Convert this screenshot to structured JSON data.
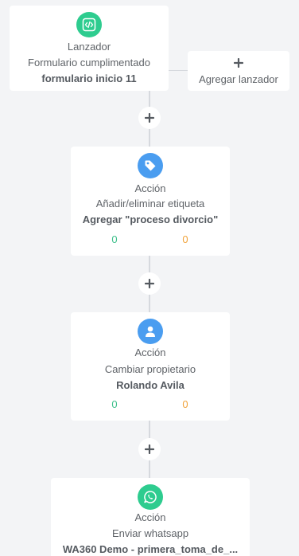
{
  "trigger": {
    "icon": "code-icon",
    "icon_color": "#2ecc8f",
    "type_label": "Lanzador",
    "event_label": "Formulario cumplimentado",
    "detail_label": "formulario inicio 11"
  },
  "add_trigger": {
    "label": "Agregar lanzador",
    "icon": "plus-icon"
  },
  "actions": [
    {
      "icon": "tag-icon",
      "icon_color": "#4a9df0",
      "type_label": "Acción",
      "action_label": "Añadir/eliminar etiqueta",
      "detail_label": "Agregar \"proceso divorcio\"",
      "success_count": "0",
      "pending_count": "0"
    },
    {
      "icon": "user-icon",
      "icon_color": "#4a9df0",
      "type_label": "Acción",
      "action_label": "Cambiar propietario",
      "detail_label": "Rolando Avila",
      "success_count": "0",
      "pending_count": "0"
    },
    {
      "icon": "whatsapp-icon",
      "icon_color": "#2ecc8f",
      "type_label": "Acción",
      "action_label": "Enviar whatsapp",
      "detail_label": "WA360 Demo - primera_toma_de_..."
    }
  ],
  "colors": {
    "background": "#f3f4f6",
    "card": "#ffffff",
    "connector": "#d6d9de",
    "success": "#3dbf8a",
    "pending": "#f0a33a"
  }
}
